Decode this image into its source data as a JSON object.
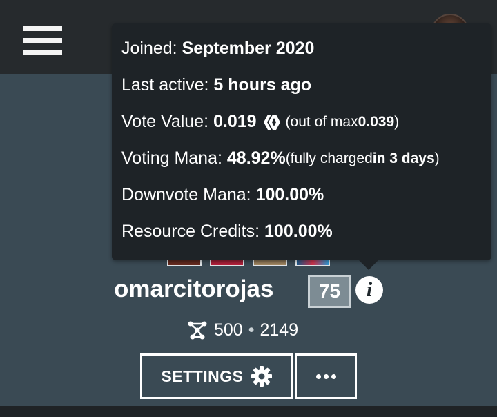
{
  "profile": {
    "username": "omarcitorojas",
    "reputation": "75",
    "info_glyph": "i",
    "following": "500",
    "separator": "•",
    "followers": "2149"
  },
  "buttons": {
    "settings_label": "SETTINGS"
  },
  "tooltip": {
    "joined_label": "Joined: ",
    "joined_value": "September 2020",
    "last_active_label": "Last active: ",
    "last_active_value": "5 hours ago",
    "vote_value_label": "Vote Value: ",
    "vote_value": "0.019",
    "vote_max_prefix": "(out of max ",
    "vote_max_value": "0.039",
    "vote_max_suffix": ")",
    "voting_mana_label": "Voting Mana: ",
    "voting_mana_value": "48.92%",
    "voting_mana_charged_prefix": "(fully charged ",
    "voting_mana_charged_value": "in 3 days",
    "voting_mana_charged_suffix": ")",
    "downvote_mana_label": "Downvote Mana: ",
    "downvote_mana_value": "100.00%",
    "resource_credits_label": "Resource Credits: ",
    "resource_credits_value": "100.00%"
  },
  "icons": {
    "menu": "hamburger-menu-icon",
    "avatar": "user-avatar",
    "hive": "hive-logo-icon",
    "info": "info-icon",
    "network": "network-icon",
    "gear": "gear-icon",
    "more": "more-dots-icon"
  },
  "colors": {
    "page_background": "#3a4a54",
    "topbar_background": "#262a2d",
    "tooltip_background": "#1e2327",
    "reputation_badge": "#7d8c94",
    "text": "#ffffff"
  }
}
